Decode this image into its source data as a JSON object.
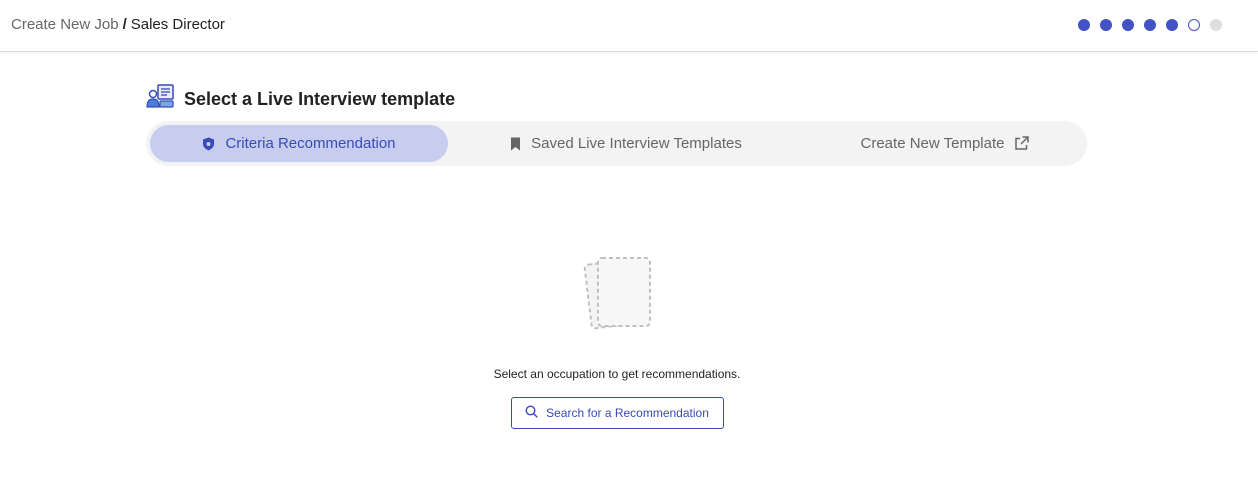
{
  "breadcrumb": {
    "parent": "Create New Job",
    "separator": "/",
    "current": "Sales Director"
  },
  "progress": {
    "total_steps": 7,
    "completed_steps": 5,
    "current_step": 6,
    "colors": {
      "done": "#4353c4",
      "pending": "#dedede"
    }
  },
  "section": {
    "title": "Select a Live Interview template",
    "icon": "live-interview-icon"
  },
  "tabs": [
    {
      "label": "Criteria Recommendation",
      "icon": "shield-icon",
      "active": true
    },
    {
      "label": "Saved Live Interview Templates",
      "icon": "bookmark-icon",
      "active": false
    },
    {
      "label": "Create New Template",
      "icon": "external-link-icon",
      "active": false
    }
  ],
  "empty_state": {
    "icon": "empty-documents-icon",
    "message": "Select an occupation to get recommendations.",
    "button_label": "Search for a Recommendation",
    "button_icon": "search-icon"
  },
  "colors": {
    "accent": "#3a4bb8",
    "active_tab_bg": "#c6cdef",
    "tab_bar_bg": "#f3f3f3"
  }
}
